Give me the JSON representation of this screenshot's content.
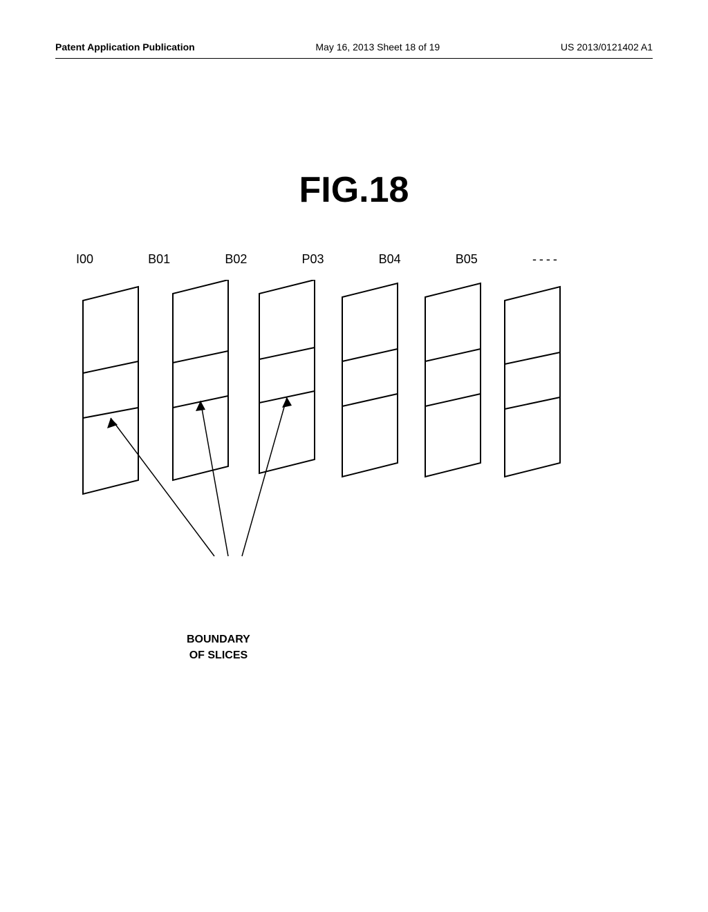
{
  "header": {
    "left_label": "Patent Application Publication",
    "center_label": "May 16, 2013  Sheet 18 of 19",
    "right_label": "US 2013/0121402 A1"
  },
  "figure": {
    "title": "FIG.18"
  },
  "frame_labels": {
    "items": [
      "I00",
      "B01",
      "B02",
      "P03",
      "B04",
      "B05",
      "----"
    ]
  },
  "boundary_label": {
    "line1": "BOUNDARY",
    "line2": "OF SLICES"
  }
}
